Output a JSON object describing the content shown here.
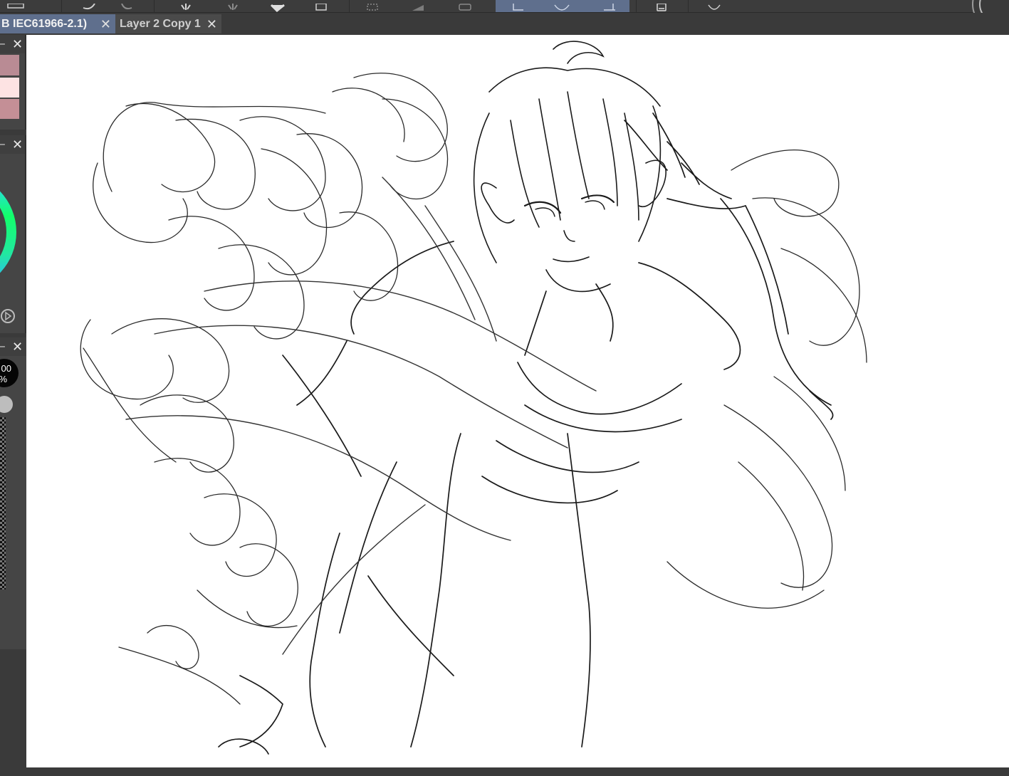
{
  "tabs": [
    {
      "label": "B IEC61966-2.1)",
      "active": true
    },
    {
      "label": "Layer 2 Copy 1",
      "active": false
    }
  ],
  "close_glyph": "✕",
  "minimize_glyph": "–",
  "opacity_readout": {
    "line1": "00",
    "line2": "%"
  },
  "palette_colors": [
    "#b98b94",
    "#fde3e3",
    "#c48f96"
  ],
  "accent_color": "#5f6f8d",
  "canvas_background": "#ffffff"
}
